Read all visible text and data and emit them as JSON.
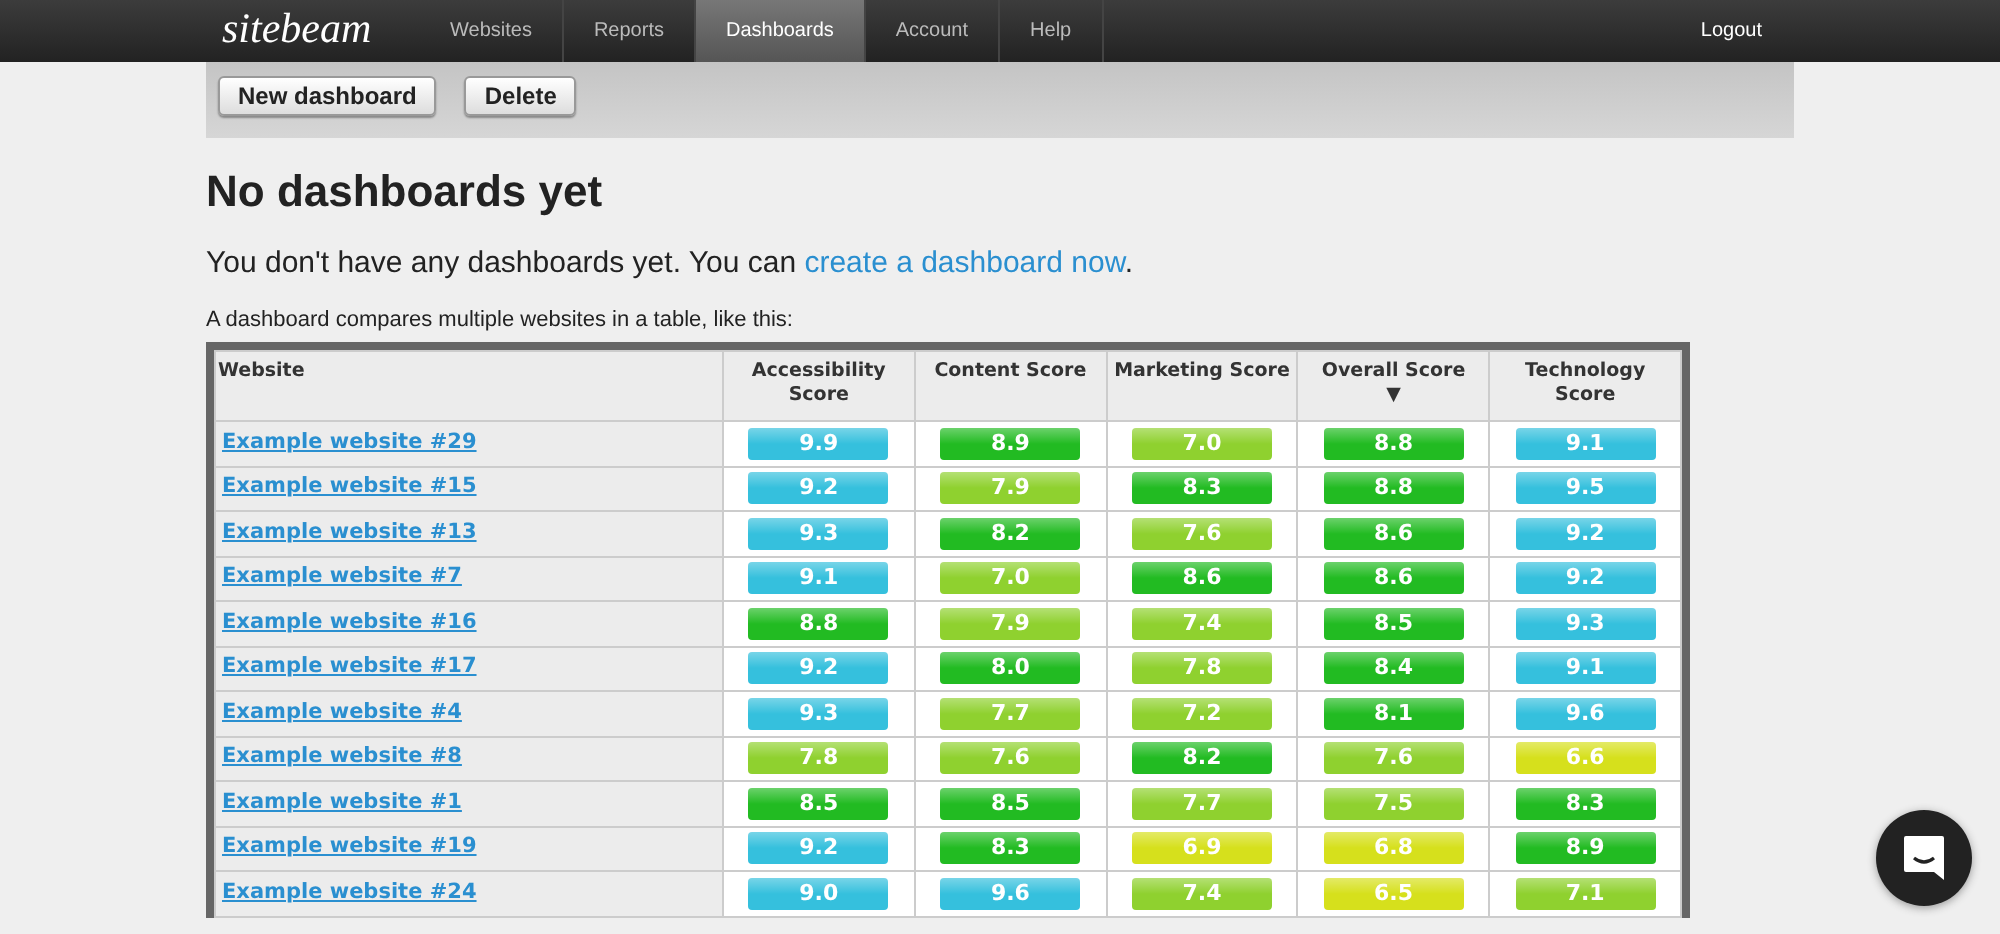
{
  "navbar": {
    "logo": "sitebeam",
    "items": [
      {
        "label": "Websites",
        "selected": false
      },
      {
        "label": "Reports",
        "selected": false
      },
      {
        "label": "Dashboards",
        "selected": true
      },
      {
        "label": "Account",
        "selected": false
      },
      {
        "label": "Help",
        "selected": false
      }
    ],
    "logout": "Logout"
  },
  "toolbar": {
    "buttons": [
      "New dashboard",
      "Delete"
    ]
  },
  "heading": "No dashboards yet",
  "intro": {
    "text": "You don't have any dashboards yet. You can ",
    "link": "create a dashboard now",
    "after": "."
  },
  "caption": "A dashboard compares multiple websites in a table, like this:",
  "table": {
    "columns": [
      {
        "label": "Website"
      },
      {
        "label": "Accessibility Score"
      },
      {
        "label": "Content Score"
      },
      {
        "label": "Marketing Score"
      },
      {
        "label": "Overall Score",
        "sort_indicator": "▼"
      },
      {
        "label": "Technology Score"
      }
    ],
    "rows": [
      {
        "website": "Example website #29",
        "scores": [
          {
            "value": "9.9",
            "color": "#35c0dd"
          },
          {
            "value": "8.9",
            "color": "#22bb22"
          },
          {
            "value": "7.0",
            "color": "#8fd12f"
          },
          {
            "value": "8.8",
            "color": "#22bb22"
          },
          {
            "value": "9.1",
            "color": "#35c0dd"
          }
        ]
      },
      {
        "website": "Example website #15",
        "scores": [
          {
            "value": "9.2",
            "color": "#35c0dd"
          },
          {
            "value": "7.9",
            "color": "#8fd12f"
          },
          {
            "value": "8.3",
            "color": "#22bb22"
          },
          {
            "value": "8.8",
            "color": "#22bb22"
          },
          {
            "value": "9.5",
            "color": "#35c0dd"
          }
        ]
      },
      {
        "website": "Example website #13",
        "scores": [
          {
            "value": "9.3",
            "color": "#35c0dd"
          },
          {
            "value": "8.2",
            "color": "#22bb22"
          },
          {
            "value": "7.6",
            "color": "#8fd12f"
          },
          {
            "value": "8.6",
            "color": "#22bb22"
          },
          {
            "value": "9.2",
            "color": "#35c0dd"
          }
        ]
      },
      {
        "website": "Example website #7",
        "scores": [
          {
            "value": "9.1",
            "color": "#35c0dd"
          },
          {
            "value": "7.0",
            "color": "#8fd12f"
          },
          {
            "value": "8.6",
            "color": "#22bb22"
          },
          {
            "value": "8.6",
            "color": "#22bb22"
          },
          {
            "value": "9.2",
            "color": "#35c0dd"
          }
        ]
      },
      {
        "website": "Example website #16",
        "scores": [
          {
            "value": "8.8",
            "color": "#22bb22"
          },
          {
            "value": "7.9",
            "color": "#8fd12f"
          },
          {
            "value": "7.4",
            "color": "#8fd12f"
          },
          {
            "value": "8.5",
            "color": "#22bb22"
          },
          {
            "value": "9.3",
            "color": "#35c0dd"
          }
        ]
      },
      {
        "website": "Example website #17",
        "scores": [
          {
            "value": "9.2",
            "color": "#35c0dd"
          },
          {
            "value": "8.0",
            "color": "#22bb22"
          },
          {
            "value": "7.8",
            "color": "#8fd12f"
          },
          {
            "value": "8.4",
            "color": "#22bb22"
          },
          {
            "value": "9.1",
            "color": "#35c0dd"
          }
        ]
      },
      {
        "website": "Example website #4",
        "scores": [
          {
            "value": "9.3",
            "color": "#35c0dd"
          },
          {
            "value": "7.7",
            "color": "#8fd12f"
          },
          {
            "value": "7.2",
            "color": "#8fd12f"
          },
          {
            "value": "8.1",
            "color": "#22bb22"
          },
          {
            "value": "9.6",
            "color": "#35c0dd"
          }
        ]
      },
      {
        "website": "Example website #8",
        "scores": [
          {
            "value": "7.8",
            "color": "#8fd12f"
          },
          {
            "value": "7.6",
            "color": "#8fd12f"
          },
          {
            "value": "8.2",
            "color": "#22bb22"
          },
          {
            "value": "7.6",
            "color": "#8fd12f"
          },
          {
            "value": "6.6",
            "color": "#d6e01c"
          }
        ]
      },
      {
        "website": "Example website #1",
        "scores": [
          {
            "value": "8.5",
            "color": "#22bb22"
          },
          {
            "value": "8.5",
            "color": "#22bb22"
          },
          {
            "value": "7.7",
            "color": "#8fd12f"
          },
          {
            "value": "7.5",
            "color": "#8fd12f"
          },
          {
            "value": "8.3",
            "color": "#22bb22"
          }
        ]
      },
      {
        "website": "Example website #19",
        "scores": [
          {
            "value": "9.2",
            "color": "#35c0dd"
          },
          {
            "value": "8.3",
            "color": "#22bb22"
          },
          {
            "value": "6.9",
            "color": "#d6e01c"
          },
          {
            "value": "6.8",
            "color": "#d6e01c"
          },
          {
            "value": "8.9",
            "color": "#22bb22"
          }
        ]
      },
      {
        "website": "Example website #24",
        "scores": [
          {
            "value": "9.0",
            "color": "#35c0dd"
          },
          {
            "value": "9.6",
            "color": "#35c0dd"
          },
          {
            "value": "7.4",
            "color": "#8fd12f"
          },
          {
            "value": "6.5",
            "color": "#d6e01c"
          },
          {
            "value": "7.1",
            "color": "#8fd12f"
          }
        ]
      }
    ]
  }
}
